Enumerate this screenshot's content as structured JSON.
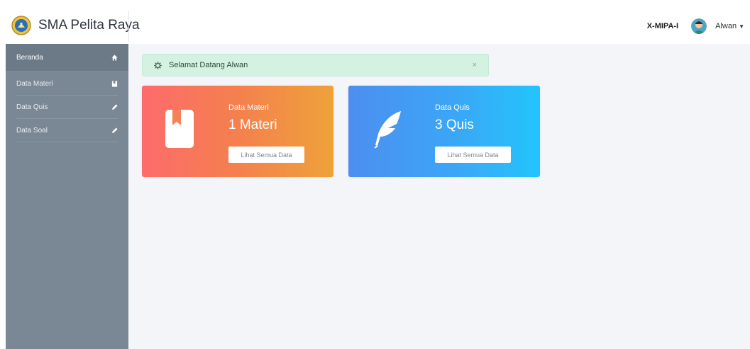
{
  "brand": {
    "name": "SMA Pelita Raya",
    "logo_icon": "school-emblem-icon"
  },
  "topbar": {
    "class_label": "X-MIPA-I",
    "user_name": "Alwan",
    "avatar_icon": "user-avatar-icon",
    "caret_icon": "caret-down-icon"
  },
  "sidebar": {
    "items": [
      {
        "label": "Beranda",
        "icon": "home-icon",
        "active": true
      },
      {
        "label": "Data Materi",
        "icon": "book-icon",
        "active": false
      },
      {
        "label": "Data Quis",
        "icon": "pencil-icon",
        "active": false
      },
      {
        "label": "Data Soal",
        "icon": "pencil-icon",
        "active": false
      }
    ]
  },
  "alert": {
    "message": "Selamat Datang Alwan",
    "icon": "gear-icon",
    "close": "×"
  },
  "cards": [
    {
      "title": "Data Materi",
      "value": "1 Materi",
      "button": "Lihat Semua Data",
      "icon": "bookmark-book-icon"
    },
    {
      "title": "Data Quis",
      "value": "3 Quis",
      "button": "Lihat Semua Data",
      "icon": "feather-icon"
    }
  ],
  "colors": {
    "sidebar": "#7a8895",
    "sidebar_active": "#6c7a87",
    "alert_bg": "#d4f2e1",
    "card_materi_start": "#fd6b6b",
    "card_materi_end": "#eea23a",
    "card_quis_start": "#4d8ef0",
    "card_quis_end": "#23c4fb"
  }
}
